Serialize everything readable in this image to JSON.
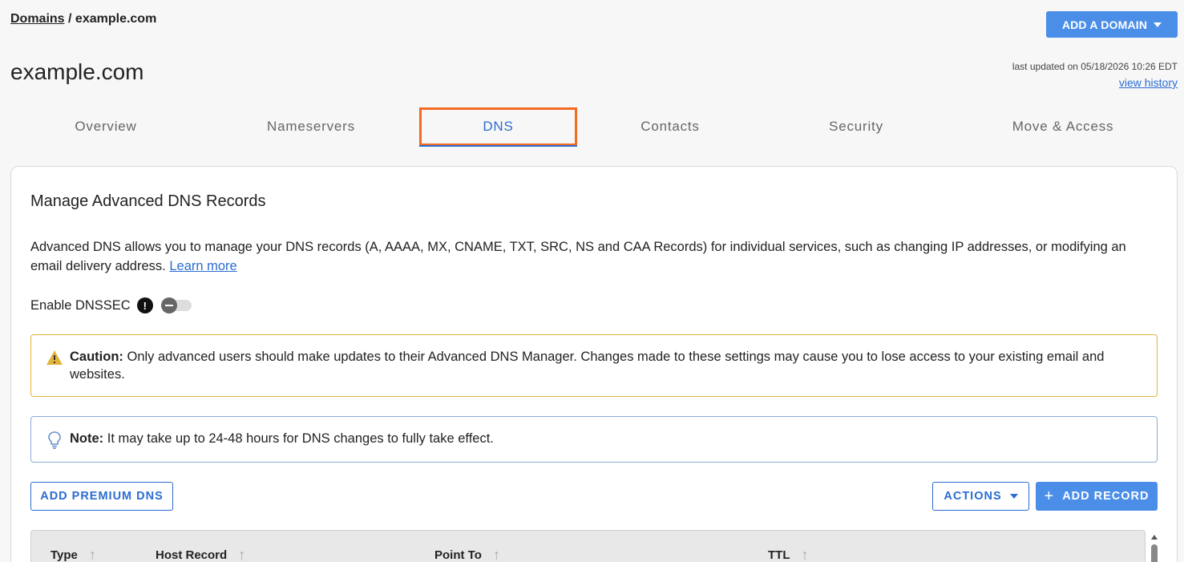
{
  "breadcrumb": {
    "root": "Domains",
    "separator": " / ",
    "current": "example.com"
  },
  "header": {
    "add_domain_label": "ADD A DOMAIN",
    "title": "example.com",
    "last_updated": "last updated on 05/18/2026 10:26 EDT",
    "view_history": "view history"
  },
  "tabs": [
    {
      "label": "Overview"
    },
    {
      "label": "Nameservers"
    },
    {
      "label": "DNS"
    },
    {
      "label": "Contacts"
    },
    {
      "label": "Security"
    },
    {
      "label": "Move & Access"
    }
  ],
  "active_tab": "DNS",
  "card": {
    "title": "Manage Advanced DNS Records",
    "description": "Advanced DNS allows you to manage your DNS records (A, AAAA, MX, CNAME, TXT, SRC, NS and CAA Records) for individual services, such as changing IP addresses, or modifying an email delivery address.",
    "learn_more": "Learn more",
    "dnssec_label": "Enable DNSSEC",
    "dnssec_enabled": false,
    "caution_label": "Caution:",
    "caution_text": "Only advanced users should make updates to their Advanced DNS Manager. Changes made to these settings may cause you to lose access to your existing email and websites.",
    "note_label": "Note:",
    "note_text": "It may take up to 24-48 hours for DNS changes to fully take effect."
  },
  "buttons": {
    "add_premium_dns": "ADD PREMIUM DNS",
    "actions": "ACTIONS",
    "add_record": "ADD RECORD"
  },
  "table": {
    "columns": [
      "Type",
      "Host Record",
      "Point To",
      "TTL"
    ]
  },
  "colors": {
    "primary": "#4a8ee8",
    "link": "#2b6cd1",
    "highlight": "#f26b22",
    "caution_border": "#e3b43c"
  }
}
